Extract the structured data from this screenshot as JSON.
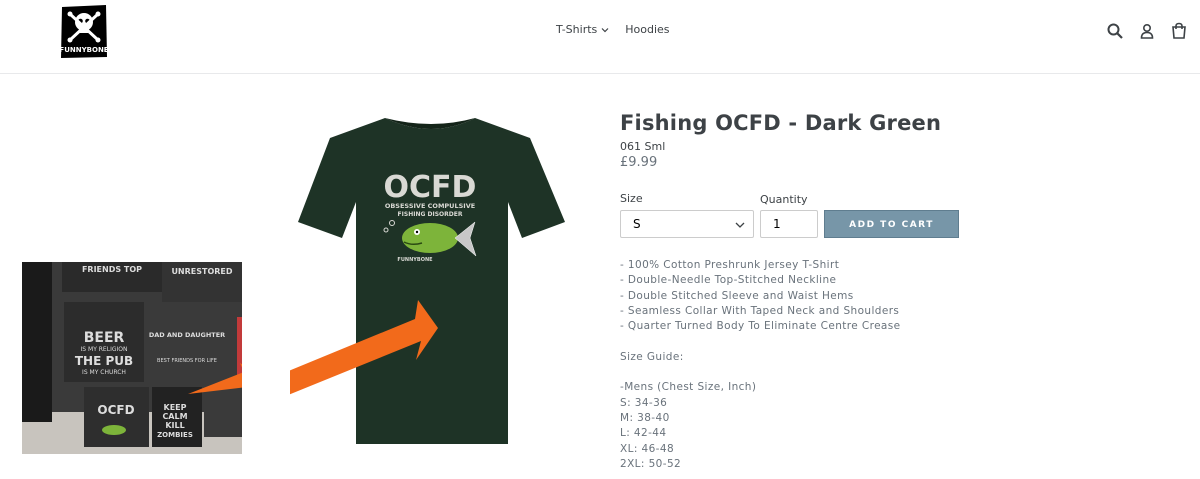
{
  "header": {
    "logo_text": "FUNNYBONE",
    "nav": [
      {
        "label": "T-Shirts"
      },
      {
        "label": "Hoodies"
      }
    ]
  },
  "product": {
    "title": "Fishing OCFD - Dark Green",
    "sku": "061 Sml",
    "price": "£9.99",
    "size_label": "Size",
    "size_value": "S",
    "quantity_label": "Quantity",
    "quantity_value": "1",
    "add_to_cart": "ADD TO CART",
    "image_text": {
      "big": "OCFD",
      "line1": "OBSESSIVE COMPULSIVE",
      "line2": "FISHING DISORDER",
      "brand": "FUNNYBONE"
    },
    "description": [
      "- 100% Cotton Preshrunk Jersey T-Shirt",
      "- Double-Needle Top-Stitched Neckline",
      "- Double Stitched Sleeve and Waist Hems",
      "- Seamless Collar With Taped Neck and Shoulders",
      "- Quarter Turned Body To Eliminate Centre Crease",
      "",
      "Size Guide:",
      "",
      "-Mens (Chest Size, Inch)",
      "S: 34-36",
      "M: 38-40",
      "L: 42-44",
      "XL: 46-48",
      "2XL: 50-52"
    ]
  },
  "photo": {
    "signs": [
      "FRIENDS TOP",
      "UNRESTORED",
      "BEER",
      "IS MY RELIGION",
      "THE PUB",
      "IS MY CHURCH",
      "DAD AND DAUGHTER",
      "BEST FRIENDS FOR LIFE",
      "OCFD",
      "KEEP",
      "CALM",
      "KILL",
      "ZOMBIES"
    ]
  },
  "colors": {
    "button": "#7796a8",
    "shirt": "#1e3326",
    "arrow": "#f26a1b"
  }
}
